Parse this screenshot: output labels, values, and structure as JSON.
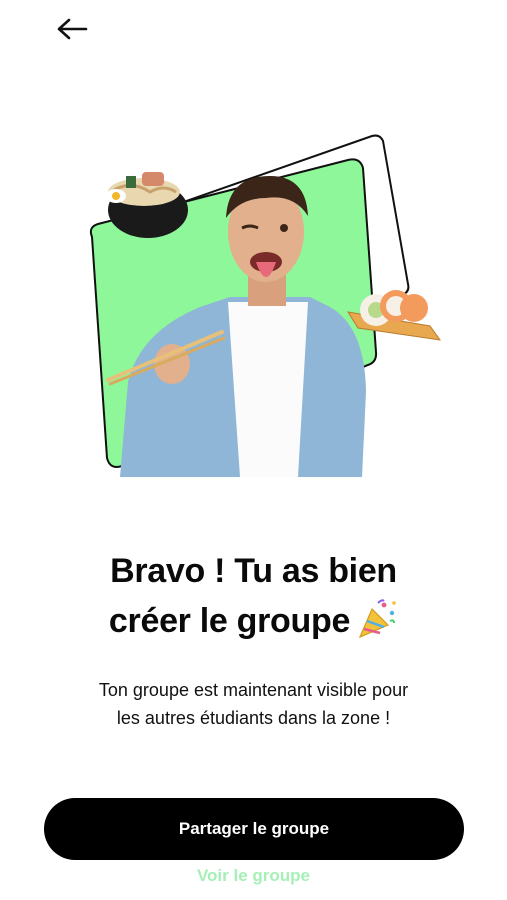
{
  "header": {
    "back_icon": "arrow-left-icon"
  },
  "colors": {
    "accent_green": "#8ef79a",
    "link_green": "#a6f0b8",
    "primary_button_bg": "#000000"
  },
  "hero": {
    "image": "man-with-chopsticks-and-sushi-illustration"
  },
  "main": {
    "title_line1": "Bravo ! Tu as bien",
    "title_line2": "créer le groupe",
    "title_icon": "party-popper-icon",
    "subtitle_line1": "Ton groupe est maintenant visible pour",
    "subtitle_line2": "les autres étudiants dans la zone !"
  },
  "actions": {
    "primary_label": "Partager le groupe",
    "secondary_label": "Voir le groupe"
  }
}
